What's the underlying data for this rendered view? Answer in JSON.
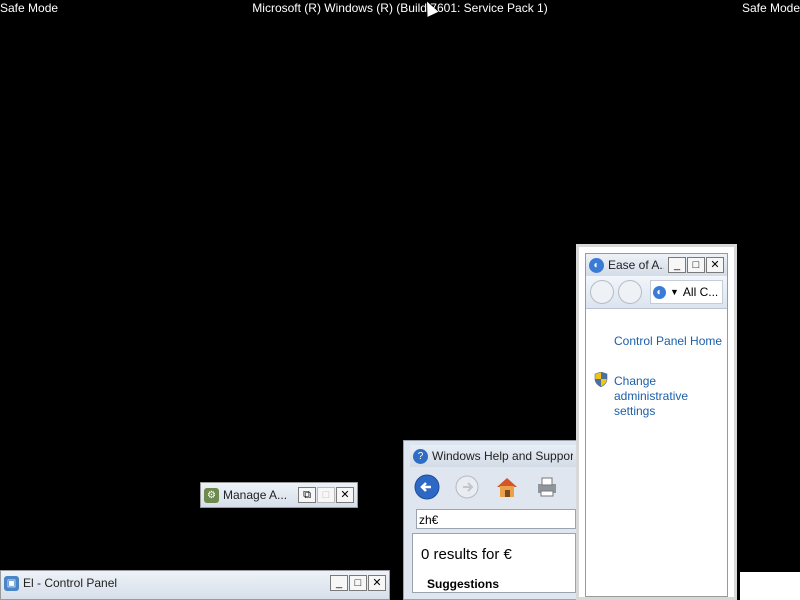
{
  "safe_mode": {
    "left_label": "Safe Mode",
    "right_label": "Safe Mode",
    "center_label": "Microsoft (R) Windows (R) (Build 7601: Service Pack 1)"
  },
  "ease_window": {
    "title": "Ease of A...",
    "address": "All C...",
    "links": {
      "home": "Control Panel Home",
      "change_admin": "Change administrative settings"
    }
  },
  "help_window": {
    "title": "Windows Help and Support",
    "search_value": "zh€",
    "results_text": "0 results for €",
    "suggestions_label": "Suggestions"
  },
  "manage_window": {
    "title": "Manage A..."
  },
  "control_panel_window": {
    "title": "El - Control Panel"
  },
  "caption": {
    "minimize": "_",
    "maximize": "□",
    "restore": "⧉",
    "close": "✕"
  },
  "colors": {
    "link": "#1c5fa8",
    "desktop": "#000000"
  }
}
